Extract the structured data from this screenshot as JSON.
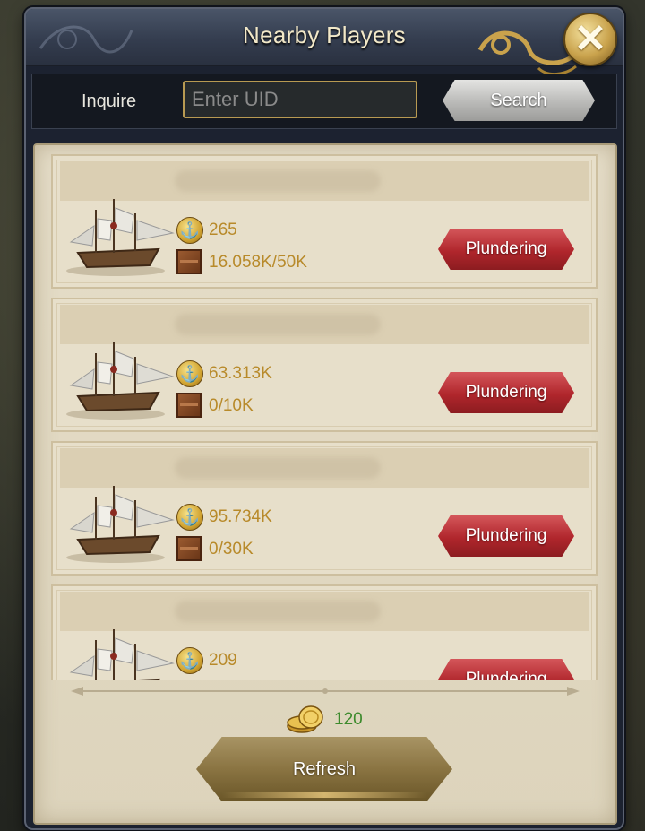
{
  "header": {
    "title": "Nearby Players",
    "close_icon": "close-icon"
  },
  "search": {
    "label": "Inquire",
    "placeholder": "Enter UID",
    "value": "",
    "button_label": "Search"
  },
  "players": [
    {
      "power": "265",
      "cargo": "16.058K/50K",
      "action_label": "Plundering"
    },
    {
      "power": "63.313K",
      "cargo": "0/10K",
      "action_label": "Plundering"
    },
    {
      "power": "95.734K",
      "cargo": "0/30K",
      "action_label": "Plundering"
    },
    {
      "power": "209",
      "cargo": "",
      "action_label": "Plundering"
    }
  ],
  "refresh": {
    "cost": "120",
    "label": "Refresh",
    "cost_icon": "gold-coins-icon"
  },
  "colors": {
    "plunder": "#b0262c",
    "stat_text": "#b88a2a",
    "cost_text": "#3c8a2c",
    "accent_gold": "#c9a24c"
  }
}
